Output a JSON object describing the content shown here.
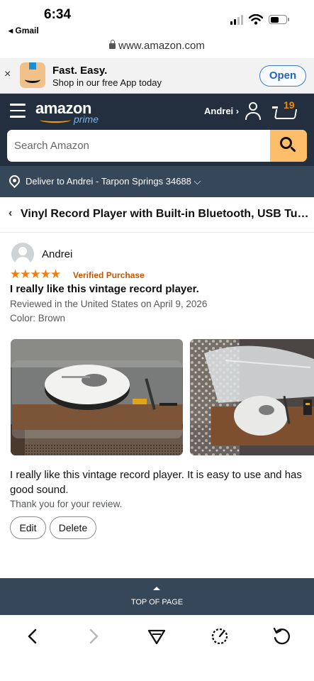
{
  "status": {
    "time": "6:34",
    "back_app": "◂ Gmail",
    "battery_level": 0.55
  },
  "browser": {
    "url": "www.amazon.com"
  },
  "app_banner": {
    "title": "Fast. Easy.",
    "subtitle": "Shop in our free App today",
    "open_label": "Open",
    "close_glyph": "×"
  },
  "header": {
    "logo": "amazon",
    "prime": "prime",
    "account": "Andrei ›",
    "cart_count": "19",
    "search_placeholder": "Search Amazon",
    "deliver_to": "Deliver to Andrei - Tarpon Springs 34688 ⌵"
  },
  "product": {
    "back_glyph": "‹",
    "title": "Vinyl Record Player with Built-in Bluetooth, USB Turntable"
  },
  "review": {
    "reviewer": "Andrei",
    "stars": "★★★★★",
    "rating": 5,
    "verified": "Verified Purchase",
    "title": "I really like this vintage record player.",
    "meta": "Reviewed in the United States on April 9, 2026",
    "color": "Color: Brown",
    "body": "I really like this vintage record player. It is easy to use and has good sound.",
    "thanks": "Thank you for your review.",
    "edit_label": "Edit",
    "delete_label": "Delete"
  },
  "footer": {
    "top_of_page": "TOP OF PAGE"
  },
  "colors": {
    "header_bg": "#232f3e",
    "subheader_bg": "#37475a",
    "search_button": "#febd69",
    "star": "#f27d0c",
    "verified": "#c45500",
    "open_button": "#2565b4"
  }
}
